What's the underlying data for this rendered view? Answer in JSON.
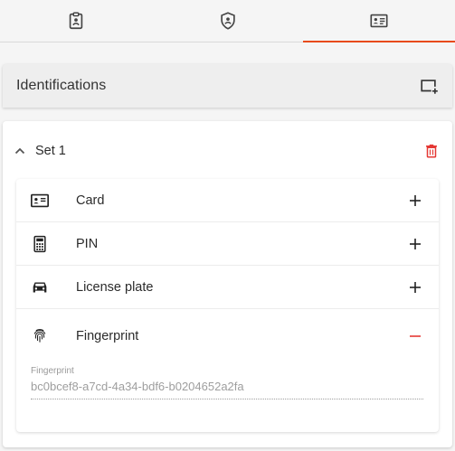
{
  "tabs": [
    {
      "icon": "badge-clipboard-icon",
      "active": false
    },
    {
      "icon": "shield-person-icon",
      "active": false
    },
    {
      "icon": "id-card-icon",
      "active": true
    }
  ],
  "header": {
    "title": "Identifications",
    "add_icon": "add-card-icon"
  },
  "set": {
    "title": "Set 1",
    "expand_icon": "chevron-up-icon",
    "delete_icon": "trash-icon",
    "delete_color": "#e53935"
  },
  "items": [
    {
      "label": "Card",
      "icon": "id-card-icon",
      "action": "plus-icon"
    },
    {
      "label": "PIN",
      "icon": "keypad-icon",
      "action": "plus-icon"
    },
    {
      "label": "License plate",
      "icon": "car-icon",
      "action": "plus-icon"
    },
    {
      "label": "Fingerprint",
      "icon": "fingerprint-icon",
      "action": "minus-icon"
    }
  ],
  "fingerprint_field": {
    "label": "Fingerprint",
    "value": "bc0bcef8-a7cd-4a34-bdf6-b0204652a2fa"
  },
  "colors": {
    "accent": "#e84a1a",
    "danger": "#e53935"
  }
}
